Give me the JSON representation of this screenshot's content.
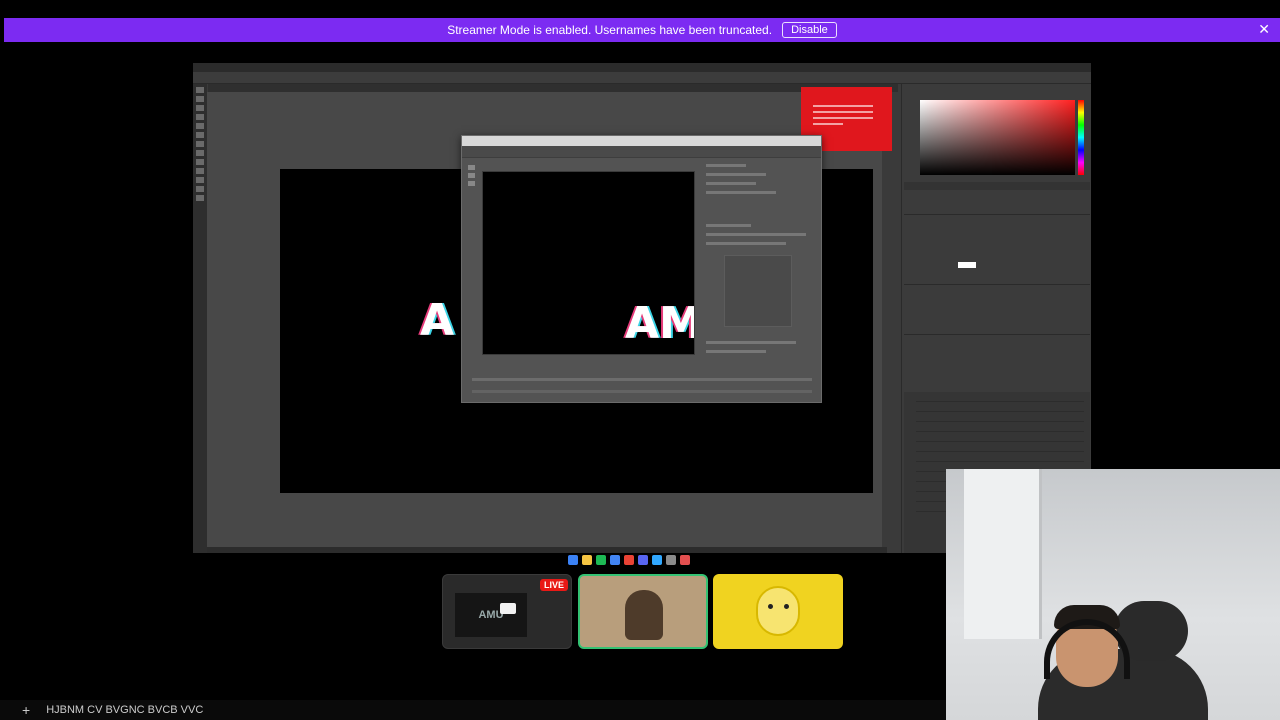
{
  "banner": {
    "message": "Streamer Mode is enabled. Usernames have been truncated.",
    "disable_label": "Disable",
    "close_glyph": "✕",
    "color": "#7c2bf2"
  },
  "stream": {
    "document_text": "A",
    "preview_text": "AM",
    "thumbnail_text": "AMU",
    "live_badge": "LIVE"
  },
  "composer": {
    "add_glyph": "+",
    "text": "HJBNM CV BVGNC BVCB VVC"
  },
  "icons": {
    "banner_close": "close-icon",
    "add": "plus-icon"
  },
  "colors": {
    "live": "#e91916",
    "active_tile_border": "#34c273",
    "popup_red": "#e0171d"
  }
}
